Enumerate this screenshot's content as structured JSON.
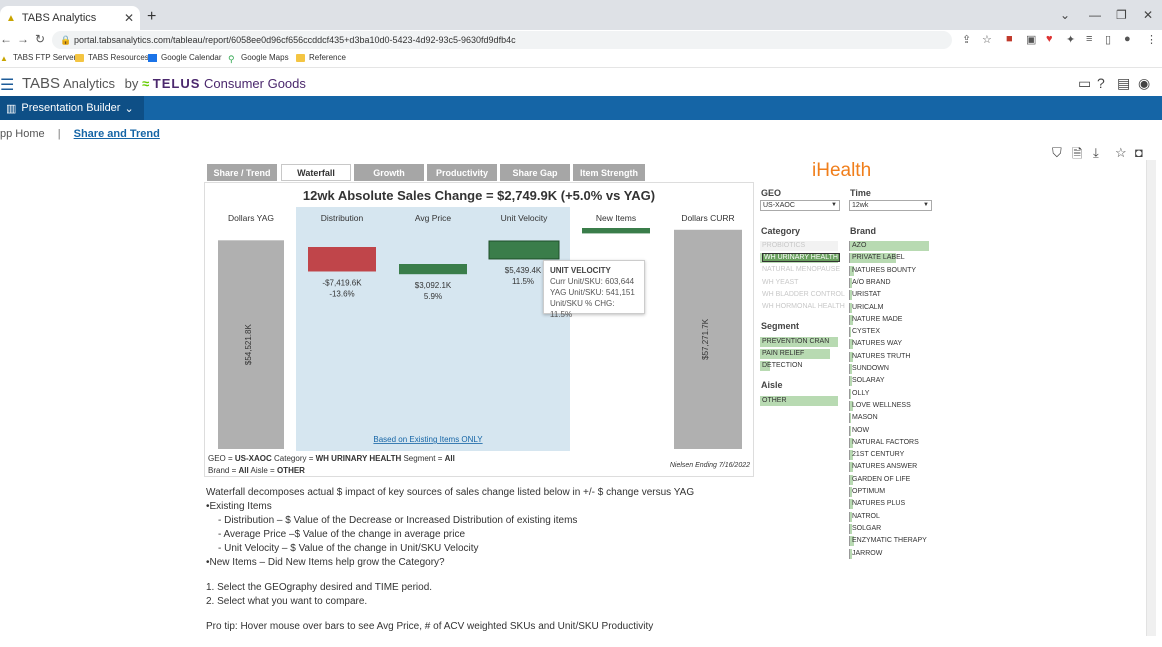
{
  "browser": {
    "tab_title": "TABS Analytics",
    "url": "portal.tabsanalytics.com/tableau/report/6058ee0d96cf656ccddcf435+d3ba10d0-5423-4d92-93c5-9630fd9dfb4c",
    "bookmarks": [
      "TABS FTP Server",
      "TABS Resources",
      "Google Calendar",
      "Google Maps",
      "Reference"
    ]
  },
  "header": {
    "brand_tabs": "TABS",
    "brand_analytics": "Analytics",
    "brand_by": "by",
    "brand_telus": "TELUS",
    "brand_cg": "Consumer Goods",
    "presentation_builder": "Presentation Builder"
  },
  "breadcrumb": {
    "home": "pp Home",
    "sep": "|",
    "current": "Share and Trend"
  },
  "dash_tabs": [
    "Share / Trend",
    "Waterfall",
    "Growth",
    "Productivity",
    "Share Gap",
    "Item Strength"
  ],
  "chart_data": {
    "type": "bar",
    "title": "12wk Absolute Sales Change = $2,749.9K (+5.0% vs YAG)",
    "categories": [
      "Dollars YAG",
      "Distribution",
      "Avg Price",
      "Unit Velocity",
      "New Items",
      "Dollars CURR"
    ],
    "values": [
      54521.8,
      -7419.6,
      3092.1,
      5439.4,
      1638.0,
      57271.7
    ],
    "value_labels": [
      "$54,521.8K",
      "-$7,419.6K",
      "$3,092.1K",
      "$5,439.4K",
      "",
      "$57,271.7K"
    ],
    "pct_labels": [
      "",
      "-13.6%",
      "5.9%",
      "11.5%",
      "",
      ""
    ],
    "existing_items_note": "Based on Existing Items ONLY",
    "colors": {
      "total": "#b0b0b0",
      "negative": "#c0454a",
      "positive": "#3a7d4a",
      "highlight": "#d6e6f0"
    }
  },
  "tooltip": {
    "title": "UNIT VELOCITY",
    "rows": [
      "Curr Unit/SKU: 603,644",
      "YAG Unit/SKU: 541,151",
      "Unit/SKU % CHG: 11.5%"
    ]
  },
  "filter_text": {
    "geo_label": "GEO = ",
    "geo": "US-XAOC",
    "cat_label": " Category = ",
    "cat": "WH URINARY HEALTH",
    "seg_label": " Segment = ",
    "seg": "All",
    "brand_label": "Brand = ",
    "brand": "All",
    "aisle_label": " Aisle = ",
    "aisle": "OTHER"
  },
  "nielsen": "Nielsen Ending 7/16/2022",
  "logo": "iHealth",
  "filters": {
    "geo_title": "GEO",
    "geo_value": "US-XAOC",
    "time_title": "Time",
    "time_value": "12wk",
    "category_title": "Category",
    "categories": [
      "PROBIOTICS",
      "WH URINARY HEALTH",
      "NATURAL MENOPAUSE",
      "WH YEAST",
      "WH BLADDER CONTROL",
      "WH HORMONAL HEALTH"
    ],
    "segment_title": "Segment",
    "segments": [
      "PREVENTION CRAN",
      "PAIN RELIEF",
      "DETECTION"
    ],
    "aisle_title": "Aisle",
    "aisles": [
      "OTHER"
    ],
    "brand_title": "Brand",
    "brands": [
      "AZO",
      "PRIVATE LABEL",
      "NATURES BOUNTY",
      "A/O BRAND",
      "URISTAT",
      "URICALM",
      "NATURE MADE",
      "CYSTEX",
      "NATURES WAY",
      "NATURES TRUTH",
      "SUNDOWN",
      "SOLARAY",
      "OLLY",
      "LOVE WELLNESS",
      "MASON",
      "NOW",
      "NATURAL FACTORS",
      "21ST CENTURY",
      "NATURES ANSWER",
      "GARDEN OF LIFE",
      "OPTIMUM",
      "NATURES PLUS",
      "NATROL",
      "SOLGAR",
      "ENZYMATIC THERAPY",
      "JARROW"
    ]
  },
  "description": [
    "Waterfall decomposes actual $ impact of key sources of sales change listed below in +/- $ change versus YAG",
    "•Existing Items",
    "    - Distribution – $ Value of the Decrease or Increased Distribution of existing items",
    "    - Average Price –$ Value of the change in average price",
    "    - Unit Velocity – $ Value of the change in Unit/SKU Velocity",
    "•New Items – Did New Items help grow the Category?",
    "1. Select the GEOgraphy desired and TIME period.",
    "2. Select what you want to compare.",
    "Pro tip: Hover mouse over bars to see Avg Price, # of ACV weighted SKUs and Unit/SKU Productivity"
  ]
}
